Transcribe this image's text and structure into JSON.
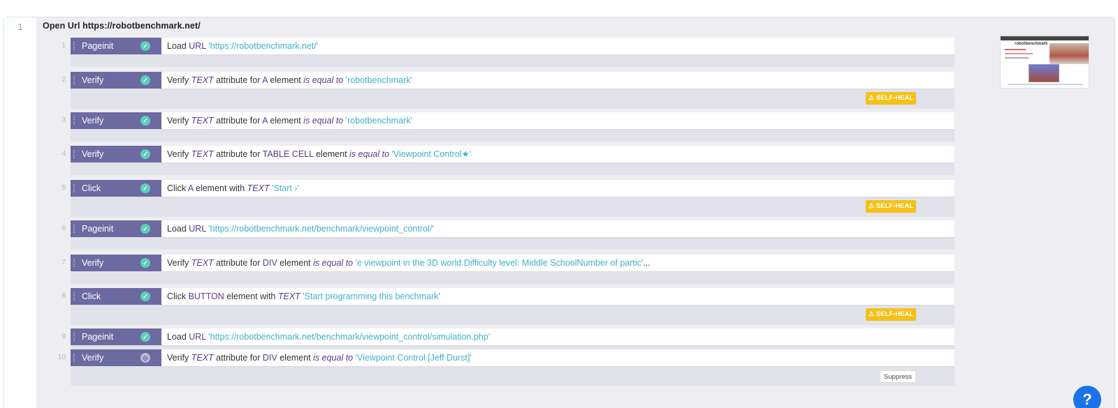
{
  "step": {
    "number": "1",
    "title_prefix": "Open Url",
    "title_url": "https://robotbenchmark.net/"
  },
  "thumbnail": {
    "logo_text": "robotbenchmark"
  },
  "rows": [
    {
      "n": "1",
      "action": "Pageinit",
      "status": "passed",
      "text": [
        [
          "kw",
          "Load "
        ],
        [
          "tok",
          "URL "
        ],
        [
          "val",
          " 'https://robotbenchmark.net/'"
        ]
      ]
    },
    {
      "n": "2",
      "action": "Verify",
      "status": "passed",
      "text": [
        [
          "kw",
          "Verify "
        ],
        [
          "it",
          "TEXT "
        ],
        [
          "kw",
          " attribute for "
        ],
        [
          "tok",
          "A "
        ],
        [
          "kw",
          " element "
        ],
        [
          "it",
          "is equal to "
        ],
        [
          "val",
          " 'robotbenchmark'"
        ]
      ],
      "badge": "SELF-HEAL"
    },
    {
      "n": "3",
      "action": "Verify",
      "status": "passed",
      "text": [
        [
          "kw",
          "Verify "
        ],
        [
          "it",
          "TEXT "
        ],
        [
          "kw",
          " attribute for "
        ],
        [
          "tok",
          "A "
        ],
        [
          "kw",
          " element "
        ],
        [
          "it",
          "is equal to "
        ],
        [
          "val",
          " 'robotbenchmark'"
        ]
      ]
    },
    {
      "n": "4",
      "action": "Verify",
      "status": "passed",
      "text": [
        [
          "kw",
          "Verify "
        ],
        [
          "it",
          "TEXT "
        ],
        [
          "kw",
          " attribute for "
        ],
        [
          "tok",
          "TABLE CELL "
        ],
        [
          "kw",
          " element "
        ],
        [
          "it",
          "is equal to "
        ],
        [
          "val",
          " 'Viewpoint Control★'"
        ]
      ]
    },
    {
      "n": "5",
      "action": "Click",
      "status": "passed",
      "text": [
        [
          "kw",
          "Click "
        ],
        [
          "tok",
          "A "
        ],
        [
          "kw",
          " element with "
        ],
        [
          "it",
          "TEXT "
        ],
        [
          "val",
          " 'Start ›'"
        ]
      ],
      "badge": "SELF-HEAL"
    },
    {
      "n": "6",
      "action": "Pageinit",
      "status": "passed",
      "text": [
        [
          "kw",
          "Load "
        ],
        [
          "tok",
          "URL "
        ],
        [
          "val",
          " 'https://robotbenchmark.net/benchmark/viewpoint_control/'"
        ]
      ]
    },
    {
      "n": "7",
      "action": "Verify",
      "status": "passed",
      "text": [
        [
          "kw",
          "Verify "
        ],
        [
          "it",
          "TEXT "
        ],
        [
          "kw",
          " attribute for "
        ],
        [
          "tok",
          "DIV "
        ],
        [
          "kw",
          " element "
        ],
        [
          "it",
          "is equal to "
        ],
        [
          "val",
          " 'e viewpoint in the 3D world.Difficulty level: Middle SchoolNumber of partic'"
        ],
        [
          "kw",
          "..."
        ]
      ]
    },
    {
      "n": "8",
      "action": "Click",
      "status": "passed",
      "text": [
        [
          "kw",
          "Click "
        ],
        [
          "tok",
          "BUTTON "
        ],
        [
          "kw",
          " element with "
        ],
        [
          "it",
          "TEXT "
        ],
        [
          "val",
          " 'Start programming this benchmark'"
        ]
      ],
      "badge": "SELF-HEAL"
    },
    {
      "n": "9",
      "action": "Pageinit",
      "status": "passed",
      "text": [
        [
          "kw",
          "Load "
        ],
        [
          "tok",
          "URL "
        ],
        [
          "val",
          " 'https://robotbenchmark.net/benchmark/viewpoint_control/simulation.php'"
        ]
      ]
    },
    {
      "n": "10",
      "action": "Verify",
      "status": "pending",
      "text": [
        [
          "kw",
          "Verify "
        ],
        [
          "it",
          "TEXT "
        ],
        [
          "kw",
          " attribute for "
        ],
        [
          "tok",
          "DIV "
        ],
        [
          "kw",
          " element "
        ],
        [
          "it",
          "is equal to "
        ],
        [
          "val",
          " 'Viewpoint Control [Jeff Durst]'"
        ]
      ],
      "button": "Suppress"
    }
  ],
  "help_label": "?",
  "colors": {
    "pill": "#6c6aa0",
    "check": "#5ccfb8",
    "value": "#3fb1c8",
    "token": "#5a3a8c",
    "self_heal": "#f5c116",
    "help": "#1a73e8"
  }
}
